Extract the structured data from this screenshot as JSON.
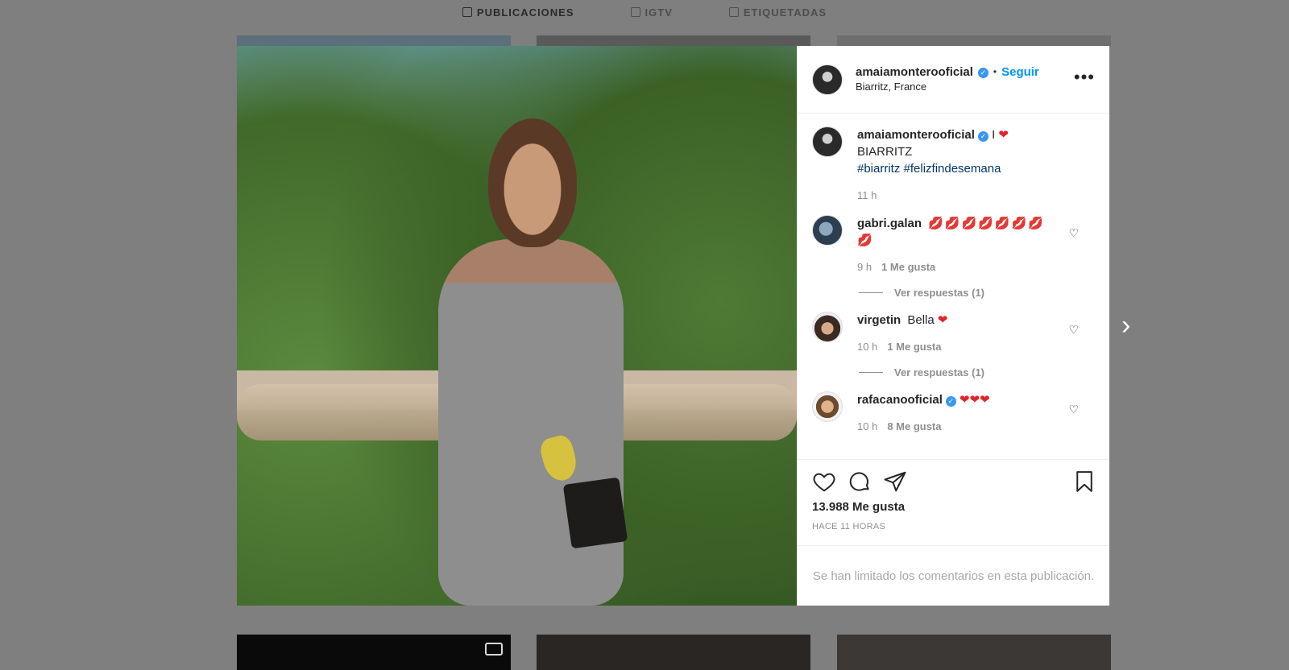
{
  "tabs": [
    {
      "label": "PUBLICACIONES",
      "icon": "grid-icon",
      "active": true
    },
    {
      "label": "IGTV",
      "icon": "igtv-icon",
      "active": false
    },
    {
      "label": "ETIQUETADAS",
      "icon": "tagged-icon",
      "active": false
    }
  ],
  "post": {
    "username": "amaiamonterooficial",
    "follow_label": "Seguir",
    "location": "Biarritz, France",
    "caption": {
      "text_prefix": "I",
      "text_suffix": "BIARRITZ",
      "hashtags": "#biarritz #felizfindesemana",
      "time": "11 h"
    },
    "likes": "13.988 Me gusta",
    "time_ago": "HACE 11 HORAS",
    "limited_notice": "Se han limitado los comentarios en esta publicación."
  },
  "comments": [
    {
      "username": "gabri.galan",
      "text": "💋💋💋💋💋💋💋💋",
      "time": "9 h",
      "likes": "1 Me gusta",
      "replies": "Ver respuestas (1)"
    },
    {
      "username": "virgetin",
      "text": "Bella",
      "time": "10 h",
      "likes": "1 Me gusta",
      "replies": "Ver respuestas (1)"
    },
    {
      "username": "rafacanooficial",
      "text": "",
      "time": "10 h",
      "likes": "8 Me gusta"
    }
  ],
  "colors": {
    "accent": "#0095f6",
    "verified": "#3897f0",
    "heart": "#e0242b"
  }
}
